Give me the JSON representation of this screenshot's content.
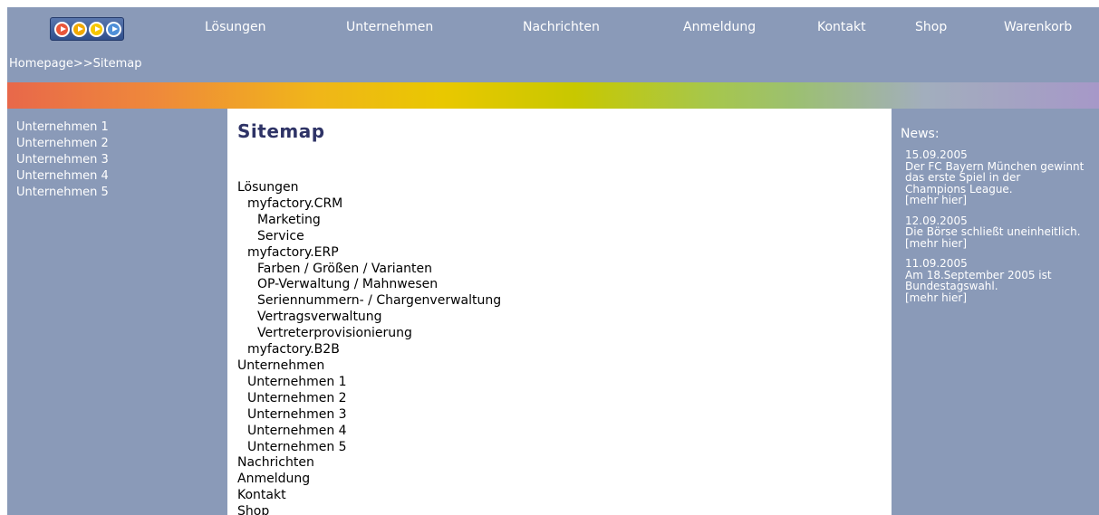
{
  "logo": {
    "icon": "play-buttons-logo",
    "dot_colors": [
      "#e8563a",
      "#f2a900",
      "#f6c800",
      "#4f8fd8"
    ]
  },
  "nav": {
    "items": [
      "Lösungen",
      "Unternehmen",
      "Nachrichten",
      "Anmeldung",
      "Kontakt",
      "Shop",
      "Warenkorb"
    ]
  },
  "breadcrumb": "Homepage>>Sitemap",
  "left_menu": {
    "items": [
      "Unternehmen 1",
      "Unternehmen 2",
      "Unternehmen 3",
      "Unternehmen 4",
      "Unternehmen 5"
    ]
  },
  "main": {
    "title": "Sitemap",
    "sitemap": [
      {
        "label": "Lösungen",
        "level": 1
      },
      {
        "label": "myfactory.CRM",
        "level": 2
      },
      {
        "label": "Marketing",
        "level": 3
      },
      {
        "label": "Service",
        "level": 3
      },
      {
        "label": "myfactory.ERP",
        "level": 2
      },
      {
        "label": "Farben / Größen / Varianten",
        "level": 3
      },
      {
        "label": "OP-Verwaltung / Mahnwesen",
        "level": 3
      },
      {
        "label": "Seriennummern- / Chargenverwaltung",
        "level": 3
      },
      {
        "label": "Vertragsverwaltung",
        "level": 3
      },
      {
        "label": "Vertreterprovisionierung",
        "level": 3
      },
      {
        "label": "myfactory.B2B",
        "level": 2
      },
      {
        "label": "Unternehmen",
        "level": 1
      },
      {
        "label": "Unternehmen 1",
        "level": 2
      },
      {
        "label": "Unternehmen 2",
        "level": 2
      },
      {
        "label": "Unternehmen 3",
        "level": 2
      },
      {
        "label": "Unternehmen 4",
        "level": 2
      },
      {
        "label": "Unternehmen 5",
        "level": 2
      },
      {
        "label": "Nachrichten",
        "level": 1
      },
      {
        "label": "Anmeldung",
        "level": 1
      },
      {
        "label": "Kontakt",
        "level": 1
      },
      {
        "label": "Shop",
        "level": 1
      }
    ]
  },
  "news": {
    "heading": "News:",
    "items": [
      {
        "date": "15.09.2005",
        "lines": [
          "Der FC Bayern München gewinnt",
          "das erste Spiel in der",
          "Champions League."
        ],
        "more": "[mehr hier]"
      },
      {
        "date": "12.09.2005",
        "lines": [
          "Die Börse schließt uneinheitlich."
        ],
        "more": "[mehr hier]"
      },
      {
        "date": "11.09.2005",
        "lines": [
          "Am 18.September 2005 ist",
          "Bundestagswahl."
        ],
        "more": "[mehr hier]"
      }
    ]
  },
  "colors": {
    "page_bg": "#8a9ab8",
    "content_bg": "#ffffff",
    "title": "#2e3366",
    "text_light": "#ffffff"
  }
}
